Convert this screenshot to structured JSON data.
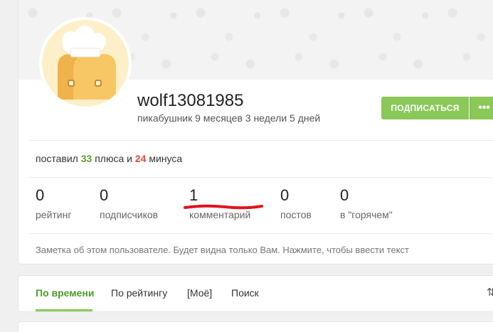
{
  "profile": {
    "username": "wolf13081985",
    "tenure": "пикабушник 9 месяцев 3 недели 5 дней",
    "subscribe_label": "ПОДПИСАТЬСЯ",
    "more_label": "•••"
  },
  "votes": {
    "prefix": "поставил",
    "plus_count": "33",
    "plus_word": "плюса",
    "conjunction": "и",
    "minus_count": "24",
    "minus_word": "минуса"
  },
  "stats": [
    {
      "value": "0",
      "label": "рейтинг"
    },
    {
      "value": "0",
      "label": "подписчиков"
    },
    {
      "value": "1",
      "label": "комментарий"
    },
    {
      "value": "0",
      "label": "постов"
    },
    {
      "value": "0",
      "label": "в \"горячем\""
    }
  ],
  "note": "Заметка об этом пользователе. Будет видна только Вам. Нажмите, чтобы ввести текст",
  "tabs": [
    {
      "label": "По времени",
      "active": true
    },
    {
      "label": "По рейтингу",
      "active": false
    },
    {
      "label": "[Моё]",
      "active": false
    },
    {
      "label": "Поиск",
      "active": false
    }
  ],
  "colors": {
    "accent": "#8ac858",
    "plus": "#5a9e2f",
    "minus": "#e0483d",
    "annotation_red": "#e0141b"
  },
  "icons": {
    "sort": "sort-icon",
    "more": "more-dots-icon"
  }
}
